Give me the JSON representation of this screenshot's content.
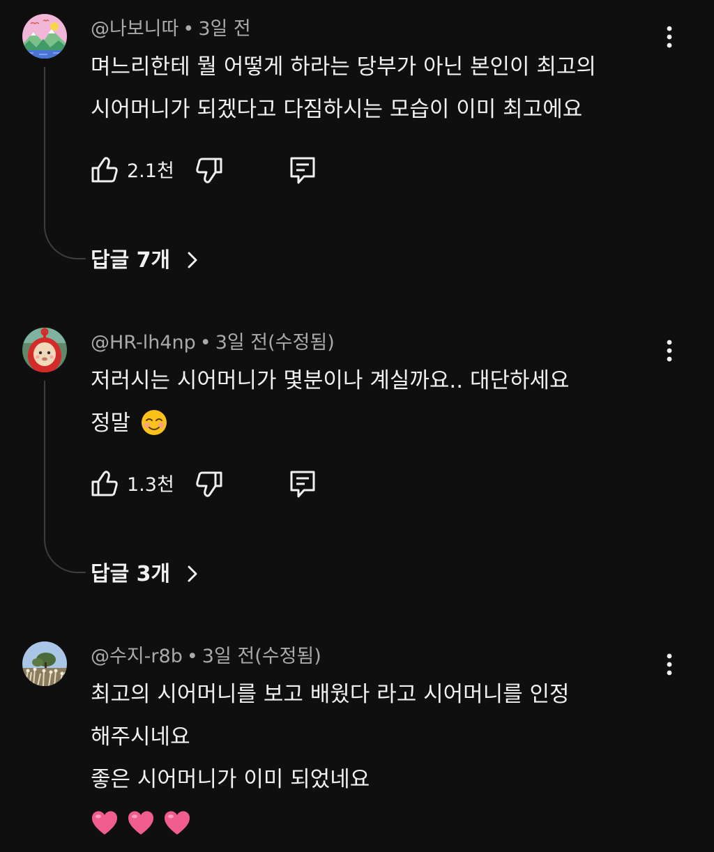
{
  "comments": [
    {
      "author": "@나보니따",
      "separator": "•",
      "time": "3일 전",
      "lines": [
        "며느리한테 뭘 어떻게 하라는 당부가 아닌 본인이 최고의",
        "시어머니가 되겠다고 다짐하시는 모습이 이미 최고에요"
      ],
      "likes": "2.1천",
      "replies_label": "답글 7개",
      "avatar_icon": "landscape-avatar-icon"
    },
    {
      "author": "@HR-lh4np",
      "separator": "•",
      "time": "3일 전(수정됨)",
      "lines": [
        "저러시는 시어머니가 몇분이나 계실까요.. 대단하세요",
        "정말"
      ],
      "likes": "1.3천",
      "replies_label": "답글 3개",
      "avatar_icon": "teletubby-avatar-icon"
    },
    {
      "author": "@수지-r8b",
      "separator": "•",
      "time": "3일 전(수정됨)",
      "lines": [
        "최고의 시어머니를 보고 배웠다 라고 시어머니를 인정",
        "해주시네요",
        "좋은 시어머니가 이미 되었네요"
      ],
      "avatar_icon": "nature-photo-avatar-icon"
    }
  ],
  "icons": {
    "like": "thumbs-up-icon",
    "dislike": "thumbs-down-icon",
    "reply": "reply-comment-icon",
    "more": "more-vertical-icon",
    "chevron": "chevron-right-icon",
    "emoji": "smiling-face-emoji",
    "hearts": "pink-heart-emoji"
  },
  "colors": {
    "background": "#0f0f0f",
    "primary_text": "#f1f1f1",
    "secondary_text": "#aaaaaa",
    "thread_line": "#3d3d3d",
    "heart": "#f25d8f"
  }
}
